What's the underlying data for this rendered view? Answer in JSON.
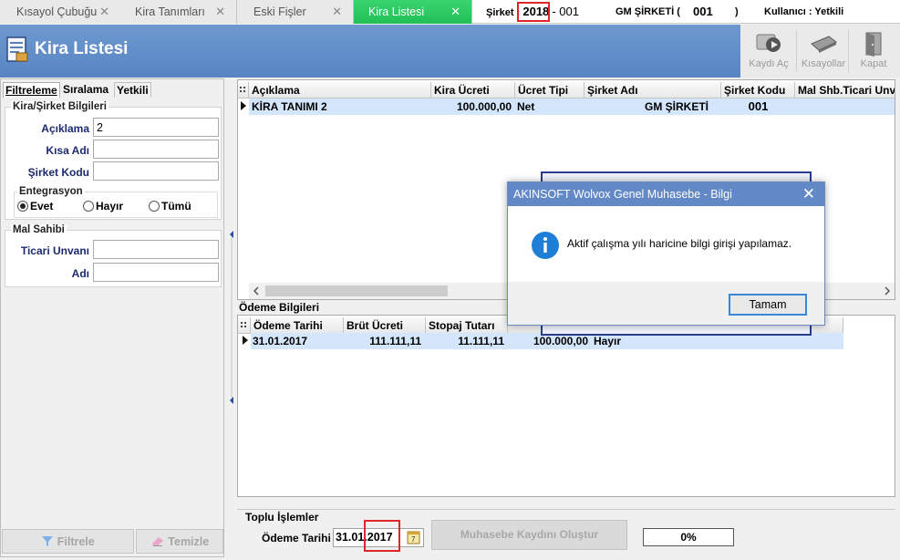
{
  "tabs": [
    {
      "label": "Kısayol Çubuğu",
      "close": "✕"
    },
    {
      "label": "Kira Tanımları",
      "close": "✕"
    },
    {
      "label": "Eski Fişler",
      "close": "✕"
    },
    {
      "label": "Kira Listesi",
      "close": "✕"
    }
  ],
  "status": {
    "sirket_label": "Şirket :",
    "year": "2018",
    "sep_code": "- 001",
    "company_name": "GM ŞİRKETİ (",
    "company_code": "001",
    "company_close": ")",
    "user": "Kullanıcı : Yetkili"
  },
  "header": {
    "title": "Kira Listesi",
    "toolbar": [
      {
        "label": "Kaydı Aç",
        "icon": "open-record-icon"
      },
      {
        "label": "Kısayollar",
        "icon": "keyboard-icon"
      },
      {
        "label": "Kapat",
        "icon": "exit-door-icon"
      }
    ]
  },
  "filter_panel": {
    "tabs": [
      "Filtreleme",
      "Sıralama",
      "Yetkili"
    ],
    "group1_title": "Kira/Şirket Bilgileri",
    "fields": [
      {
        "label": "Açıklama",
        "value": "2"
      },
      {
        "label": "Kısa Adı",
        "value": ""
      },
      {
        "label": "Şirket Kodu",
        "value": ""
      }
    ],
    "integration": {
      "title": "Entegrasyon",
      "options": [
        "Evet",
        "Hayır",
        "Tümü"
      ],
      "selected": "Evet"
    },
    "group2_title": "Mal Sahibi",
    "fields2": [
      {
        "label": "Ticari Unvanı",
        "value": ""
      },
      {
        "label": "Adı",
        "value": ""
      }
    ],
    "filter_button": "Filtrele",
    "clear_button": "Temizle"
  },
  "main_grid": {
    "headers": [
      "Açıklama",
      "Kira Ücreti",
      "Ücret Tipi",
      "Şirket Adı",
      "Şirket Kodu",
      "Mal Shb.Ticari Unva"
    ],
    "rows": [
      [
        "KİRA TANIMI 2",
        "100.000,00",
        "Net",
        "GM ŞİRKETİ",
        "001",
        ""
      ]
    ]
  },
  "payments": {
    "title": "Ödeme Bilgileri",
    "headers": [
      "Ödeme Tarihi",
      "Brüt Ücreti",
      "Stopaj Tutarı",
      "",
      ""
    ],
    "rows": [
      [
        "31.01.2017",
        "111.111,11",
        "11.111,11",
        "100.000,00",
        "Hayır"
      ]
    ]
  },
  "bulk": {
    "title": "Toplu İşlemler",
    "date_label": "Ödeme Tarihi",
    "date_day": "31.01.",
    "date_year": "2017",
    "create_button": "Muhasebe Kaydını Oluştur",
    "progress": "0%"
  },
  "dialog": {
    "title": "AKINSOFT Wolvox Genel Muhasebe - Bilgi",
    "close": "✕",
    "message": "Aktif çalışma yılı haricine bilgi girişi yapılamaz.",
    "ok": "Tamam",
    "icon": "info-icon"
  },
  "colors": {
    "accent": "#5884c3",
    "active_tab": "#22bf56",
    "highlight": "#e0262a",
    "selected_row": "#d4e6fb"
  }
}
